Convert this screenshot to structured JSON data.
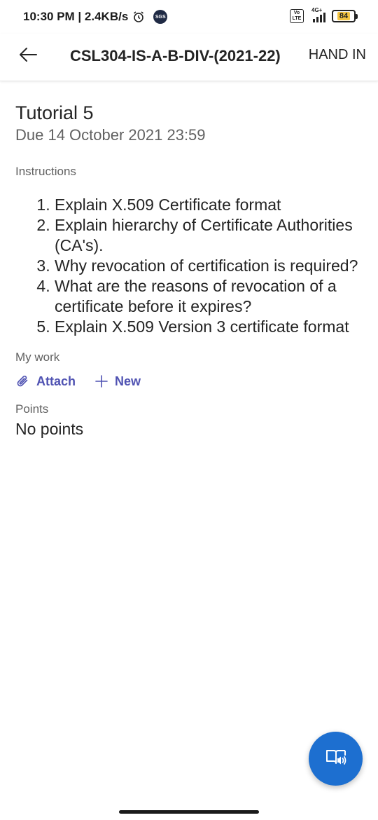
{
  "status_bar": {
    "time_speed": "10:30 PM | 2.4KB/s",
    "sgs_badge": "SGS",
    "volte_top": "Vo",
    "volte_bottom": "LTE",
    "network_type": "4G+",
    "battery_level": "84"
  },
  "app_bar": {
    "title": "CSL304-IS-A-B-DIV-(2021-22)",
    "hand_in_label": "HAND IN"
  },
  "assignment": {
    "title": "Tutorial 5",
    "due": "Due 14 October 2021 23:59",
    "instructions_label": "Instructions",
    "instructions": [
      "Explain X.509 Certificate format",
      "Explain hierarchy of Certificate Authorities (CA's).",
      "Why revocation of certification is required?",
      "What are the reasons of revocation of a certificate before it expires?",
      "Explain X.509 Version 3 certificate format"
    ]
  },
  "my_work": {
    "label": "My work",
    "attach_label": "Attach",
    "new_label": "New"
  },
  "points": {
    "label": "Points",
    "value": "No points"
  },
  "colors": {
    "accent": "#4f52b2",
    "fab": "#1d6fd0",
    "muted_text": "#616161"
  },
  "icons": {
    "back": "arrow-left-icon",
    "attach": "paperclip-icon",
    "new": "plus-icon",
    "fab": "immersive-reader-icon"
  }
}
